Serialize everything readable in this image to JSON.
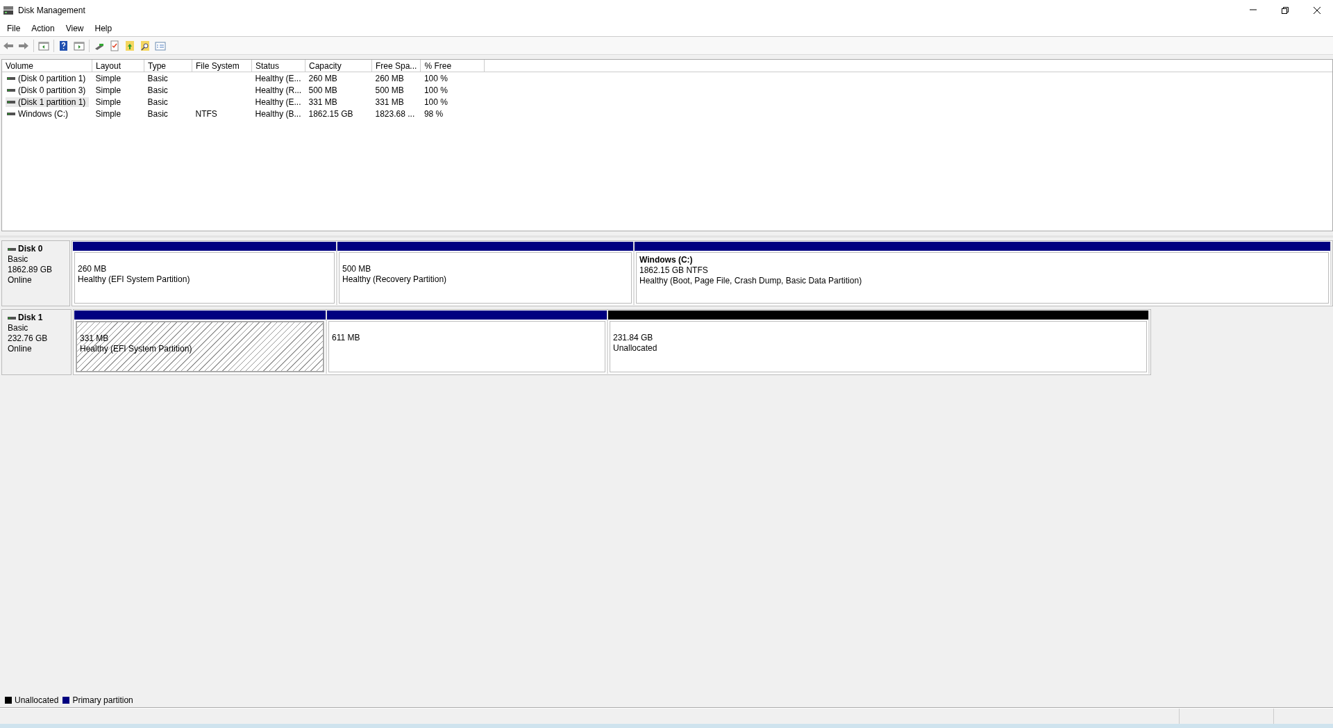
{
  "window": {
    "title": "Disk Management"
  },
  "menu": [
    {
      "label": "File"
    },
    {
      "label": "Action"
    },
    {
      "label": "View"
    },
    {
      "label": "Help"
    }
  ],
  "volume_list": {
    "columns": [
      "Volume",
      "Layout",
      "Type",
      "File System",
      "Status",
      "Capacity",
      "Free Spa...",
      "% Free"
    ],
    "rows": [
      {
        "selected": false,
        "cells": [
          "(Disk 0 partition 1)",
          "Simple",
          "Basic",
          "",
          "Healthy (E...",
          "260 MB",
          "260 MB",
          "100 %"
        ]
      },
      {
        "selected": false,
        "cells": [
          "(Disk 0 partition 3)",
          "Simple",
          "Basic",
          "",
          "Healthy (R...",
          "500 MB",
          "500 MB",
          "100 %"
        ]
      },
      {
        "selected": true,
        "cells": [
          "(Disk 1 partition 1)",
          "Simple",
          "Basic",
          "",
          "Healthy (E...",
          "331 MB",
          "331 MB",
          "100 %"
        ]
      },
      {
        "selected": false,
        "cells": [
          "Windows (C:)",
          "Simple",
          "Basic",
          "NTFS",
          "Healthy (B...",
          "1862.15 GB",
          "1823.68 ...",
          "98 %"
        ]
      }
    ]
  },
  "disks": [
    {
      "name": "Disk 0",
      "type": "Basic",
      "size": "1862.89 GB",
      "status": "Online",
      "partitions": [
        {
          "kind": "primary",
          "selected": false,
          "size": "260 MB",
          "status": "Healthy (EFI System Partition)"
        },
        {
          "kind": "primary",
          "selected": false,
          "size": "500 MB",
          "status": "Healthy (Recovery Partition)"
        },
        {
          "kind": "primary",
          "selected": false,
          "title": "Windows  (C:)",
          "size": "1862.15 GB NTFS",
          "status": "Healthy (Boot, Page File, Crash Dump, Basic Data Partition)"
        }
      ]
    },
    {
      "name": "Disk 1",
      "type": "Basic",
      "size": "232.76 GB",
      "status": "Online",
      "partitions": [
        {
          "kind": "primary",
          "selected": true,
          "size": "331 MB",
          "status": "Healthy (EFI System Partition)"
        },
        {
          "kind": "primary",
          "selected": false,
          "size": "611 MB"
        },
        {
          "kind": "unallocated",
          "selected": false,
          "size": "231.84 GB",
          "status": "Unallocated"
        }
      ]
    }
  ],
  "legend": [
    {
      "label": "Unallocated",
      "color": "#000000"
    },
    {
      "label": "Primary partition",
      "color": "#000080"
    }
  ]
}
